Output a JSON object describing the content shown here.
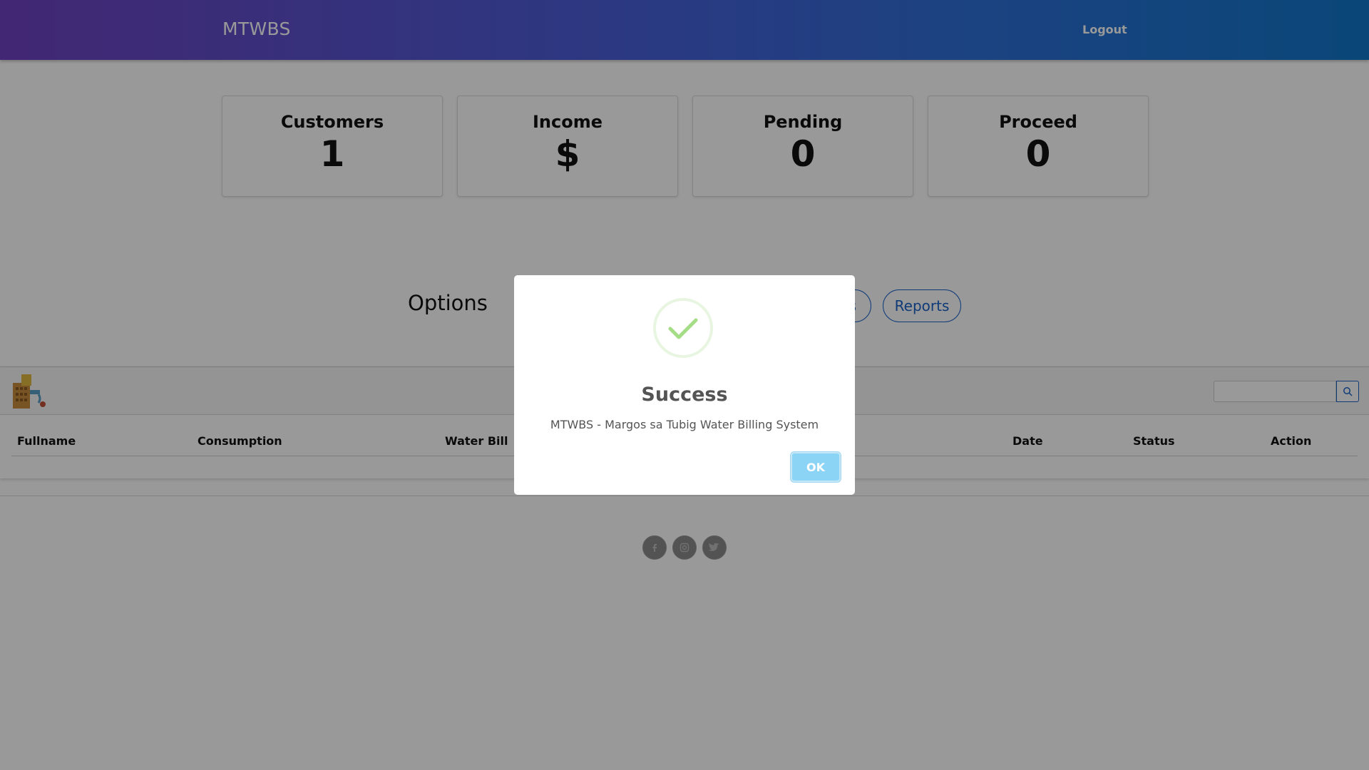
{
  "navbar": {
    "brand": "MTWBS",
    "logout": "Logout"
  },
  "stats": [
    {
      "title": "Customers",
      "value": "1"
    },
    {
      "title": "Income",
      "value": "$"
    },
    {
      "title": "Pending",
      "value": "0"
    },
    {
      "title": "Proceed",
      "value": "0"
    }
  ],
  "options": {
    "title": "Options",
    "reports": "Reports",
    "partial_button_text": "s"
  },
  "table": {
    "headers": [
      "Fullname",
      "Consumption",
      "Water Bill",
      "Date",
      "Status",
      "Action"
    ]
  },
  "modal": {
    "title": "Success",
    "message": "MTWBS - Margos sa Tubig Water Billing System",
    "ok": "OK"
  },
  "colors": {
    "accent": "#1a62c9",
    "success": "#a5dc86",
    "ok_button": "#8cd4f5"
  },
  "icons": [
    "search-icon",
    "facebook-icon",
    "instagram-icon",
    "twitter-icon",
    "check-icon",
    "water-billing-logo-icon"
  ]
}
